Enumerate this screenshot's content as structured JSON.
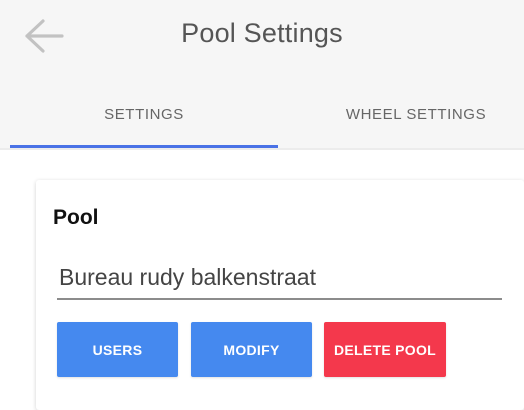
{
  "header": {
    "title": "Pool Settings",
    "back_icon": "back-arrow-icon"
  },
  "tabs": [
    {
      "label": "SETTINGS",
      "active": true
    },
    {
      "label": "WHEEL SETTINGS",
      "active": false
    }
  ],
  "card": {
    "title": "Pool",
    "pool_name_value": "Bureau rudy balkenstraat",
    "buttons": {
      "users_label": "USERS",
      "modify_label": "MODIFY",
      "delete_label": "DELETE POOL"
    }
  },
  "colors": {
    "accent": "#4a72e6",
    "primary_button": "#4589ef",
    "danger_button": "#f4384c"
  }
}
